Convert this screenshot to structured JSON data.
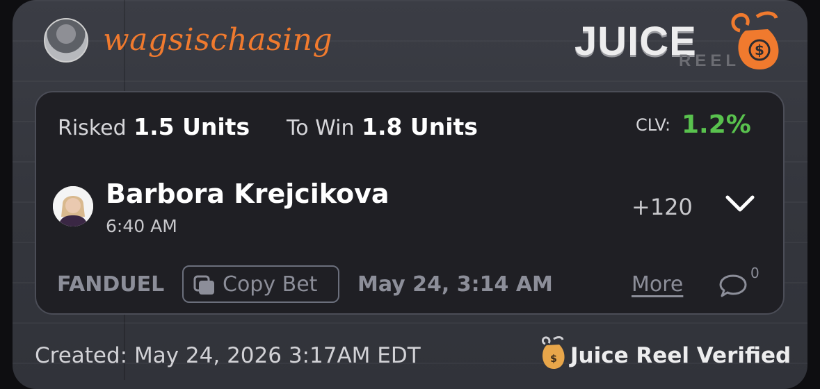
{
  "header": {
    "username": "wagsischasing",
    "logo_title": "JUICE",
    "logo_subtitle": "REEL"
  },
  "bet": {
    "risked_label": "Risked",
    "risked_value": "1.5 Units",
    "to_win_label": "To Win",
    "to_win_value": "1.8 Units",
    "clv_label": "CLV:",
    "clv_value": "1.2%",
    "player_name": "Barbora Krejcikova",
    "event_time": "6:40 AM",
    "odds": "+120",
    "sportsbook": "FANDUEL",
    "copy_bet_label": "Copy Bet",
    "placed_date": "May 24, 3:14 AM",
    "more_label": "More",
    "comment_count": "0"
  },
  "footer": {
    "created": "Created: May 24, 2026 3:17AM EDT",
    "verified": "Juice Reel Verified"
  },
  "colors": {
    "accent_orange": "#f07a2e",
    "clv_green": "#59c24e",
    "card_bg": "#1f1f24",
    "muted_text": "#8c8e99"
  },
  "icons": {
    "user_avatar": "avatar",
    "player_avatar": "avatar",
    "expand": "chevron-down-icon",
    "copy": "copy-icon",
    "comment": "comment-bubble-icon",
    "logo": "money-bag-icon"
  }
}
